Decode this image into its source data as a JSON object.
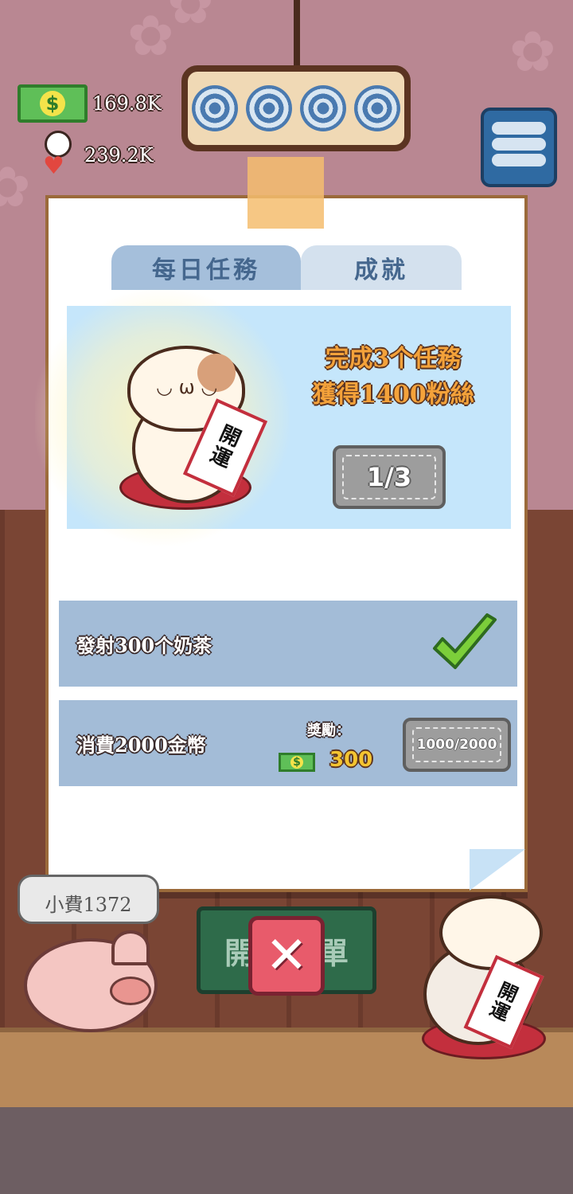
{
  "hud": {
    "money_value": "169.8K",
    "money_icon": "money-bill-icon",
    "fans_value": "239.2K",
    "fans_icon": "fan-heart-icon",
    "dollar_symbol": "$"
  },
  "modal": {
    "tabs": [
      {
        "label": "每日任務",
        "active": true
      },
      {
        "label": "成就",
        "active": false
      }
    ],
    "banner": {
      "line1": "完成3个任務",
      "line2": "獲得1400粉絲",
      "progress": "1/3",
      "sign_text_top": "開",
      "sign_text_bottom": "運"
    },
    "tasks": [
      {
        "label": "發射300个奶茶",
        "status": "completed"
      },
      {
        "label": "消費2000金幣",
        "reward_label": "獎勵：",
        "reward_amount": "300",
        "progress": "1000/2000"
      }
    ]
  },
  "background": {
    "speech_text": "小費1372",
    "board_left": "開",
    "board_right": "單",
    "cat_sign_top": "開",
    "cat_sign_bottom": "運"
  },
  "colors": {
    "accent_orange": "#f4a23a",
    "tab_text": "#45678e",
    "task_row": "#a3bcd7",
    "close_red": "#e85b6b"
  }
}
